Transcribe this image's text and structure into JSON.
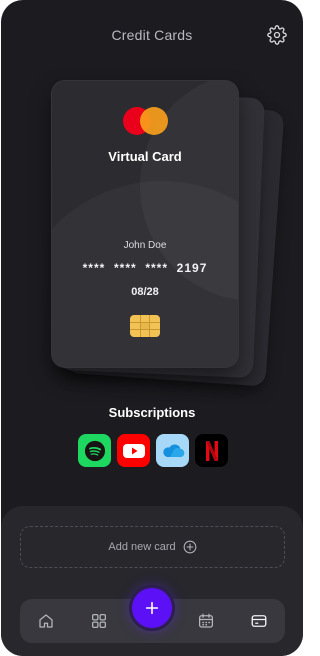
{
  "header": {
    "title": "Credit Cards",
    "settings_icon": "gear-icon"
  },
  "card": {
    "brand_logo": "mastercard-logo",
    "name": "Virtual Card",
    "holder": "John Doe",
    "number": "****  ****  ****  2197",
    "expiry": "08/28",
    "chip_icon": "chip-icon"
  },
  "subscriptions": {
    "title": "Subscriptions",
    "items": [
      {
        "icon": "spotify-icon",
        "color": "#1ed760"
      },
      {
        "icon": "youtube-icon",
        "color": "#ff0000"
      },
      {
        "icon": "onedrive-icon",
        "color": "#a8d8f8"
      },
      {
        "icon": "netflix-icon",
        "color": "#000000"
      }
    ]
  },
  "add_card": {
    "label": "Add new card",
    "icon": "plus-circle-icon"
  },
  "nav": {
    "items": [
      {
        "icon": "home-icon"
      },
      {
        "icon": "grid-icon"
      },
      {
        "icon": "calendar-icon"
      },
      {
        "icon": "card-icon",
        "active": true
      }
    ],
    "fab_icon": "plus-icon"
  },
  "colors": {
    "accent": "#5c10f5",
    "background": "#1c1c20",
    "panel": "#27272c"
  }
}
